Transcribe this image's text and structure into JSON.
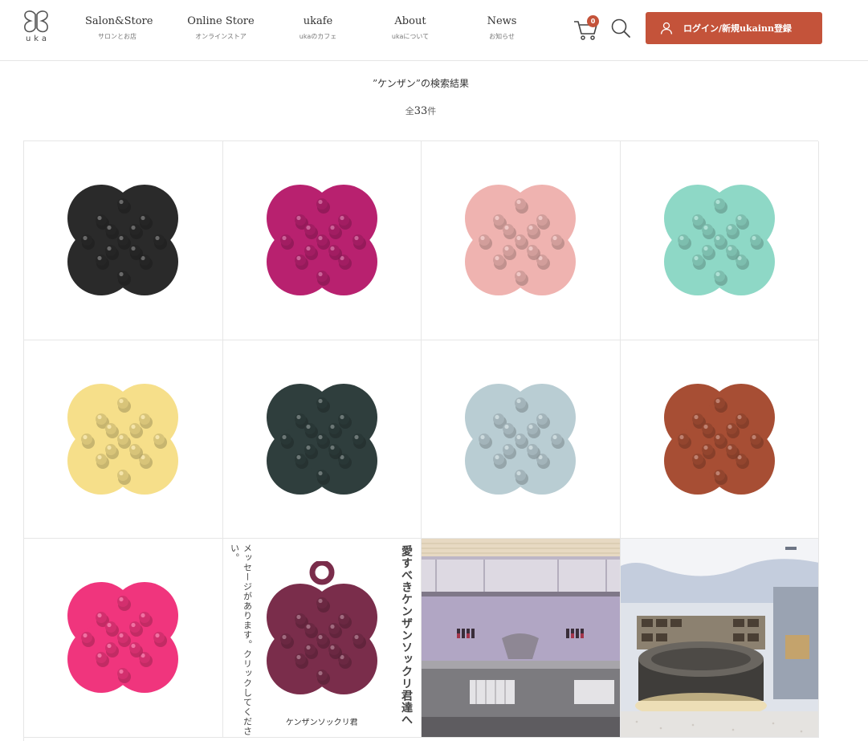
{
  "header": {
    "logo_text": "uka",
    "nav": [
      {
        "label": "Salon&Store",
        "sub": "サロンとお店"
      },
      {
        "label": "Online Store",
        "sub": "オンラインストア"
      },
      {
        "label": "ukafe",
        "sub": "ukaのカフェ"
      },
      {
        "label": "About",
        "sub": "ukaについて"
      },
      {
        "label": "News",
        "sub": "お知らせ"
      }
    ],
    "cart_count": "0",
    "login_label": "ログイン/新規ukainn登録",
    "accent_color": "#c4533a"
  },
  "results": {
    "title": "”ケンザン”の検索結果",
    "count_prefix": "全",
    "count": "33",
    "count_suffix": "件"
  },
  "products": [
    {
      "color": "#2a2a2a"
    },
    {
      "color": "#b8216f"
    },
    {
      "color": "#efb3b0"
    },
    {
      "color": "#8ed8c6"
    },
    {
      "color": "#f6df8a"
    },
    {
      "color": "#2f3e3d"
    },
    {
      "color": "#b9cdd3"
    },
    {
      "color": "#a74e34"
    },
    {
      "color": "#f0357d"
    }
  ],
  "promo": {
    "vertical_right": "愛すべきケンザンソックリ君達へ",
    "vertical_left": "メッセージがあります。クリックしてください。",
    "caption": "ケンザンソックリ君",
    "brush_color": "#7a2d4b"
  }
}
